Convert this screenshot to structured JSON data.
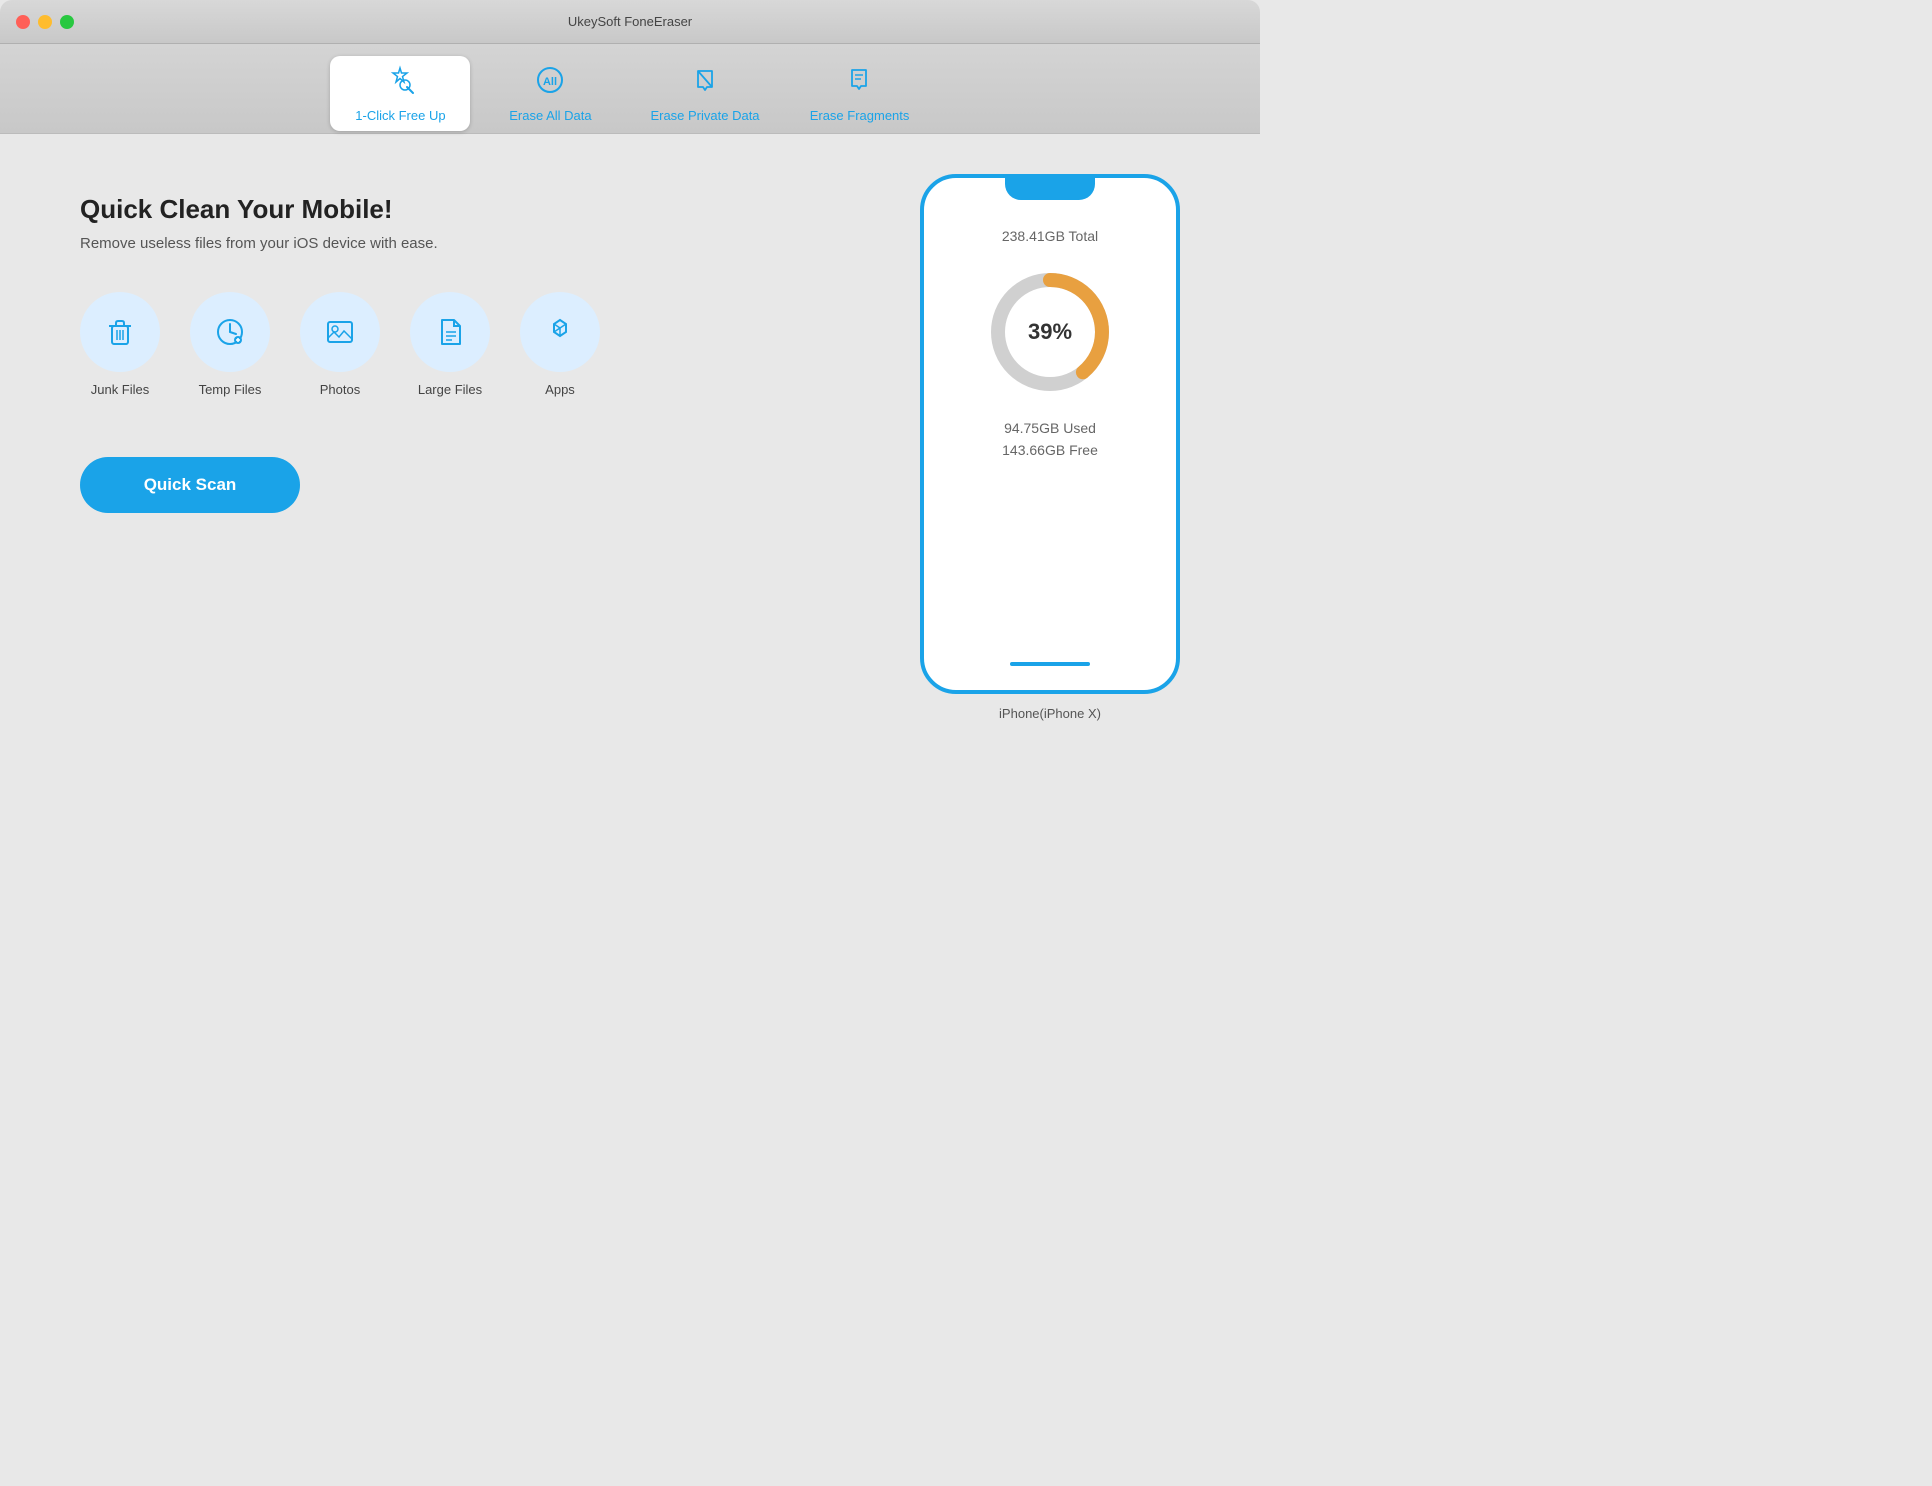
{
  "window": {
    "title": "UkeySoft FoneEraser"
  },
  "tabs": [
    {
      "id": "one-click",
      "label": "1-Click Free Up",
      "active": true,
      "icon": "✦"
    },
    {
      "id": "erase-all",
      "label": "Erase All Data",
      "active": false,
      "icon": "All"
    },
    {
      "id": "erase-private",
      "label": "Erase Private Data",
      "active": false,
      "icon": "◇"
    },
    {
      "id": "erase-fragments",
      "label": "Erase Fragments",
      "active": false,
      "icon": "◈"
    }
  ],
  "main": {
    "headline": "Quick Clean Your Mobile!",
    "subtext": "Remove useless files from your iOS device with ease.",
    "features": [
      {
        "id": "junk-files",
        "label": "Junk Files",
        "icon": "🗑"
      },
      {
        "id": "temp-files",
        "label": "Temp Files",
        "icon": "🕐"
      },
      {
        "id": "photos",
        "label": "Photos",
        "icon": "🖼"
      },
      {
        "id": "large-files",
        "label": "Large Files",
        "icon": "📄"
      },
      {
        "id": "apps",
        "label": "Apps",
        "icon": "⊞"
      }
    ],
    "quick_scan_label": "Quick Scan"
  },
  "device": {
    "name": "iPhone(iPhone X)",
    "total": "238.41GB Total",
    "used": "94.75GB Used",
    "free": "143.66GB Free",
    "percent": "39%",
    "percent_value": 39
  }
}
